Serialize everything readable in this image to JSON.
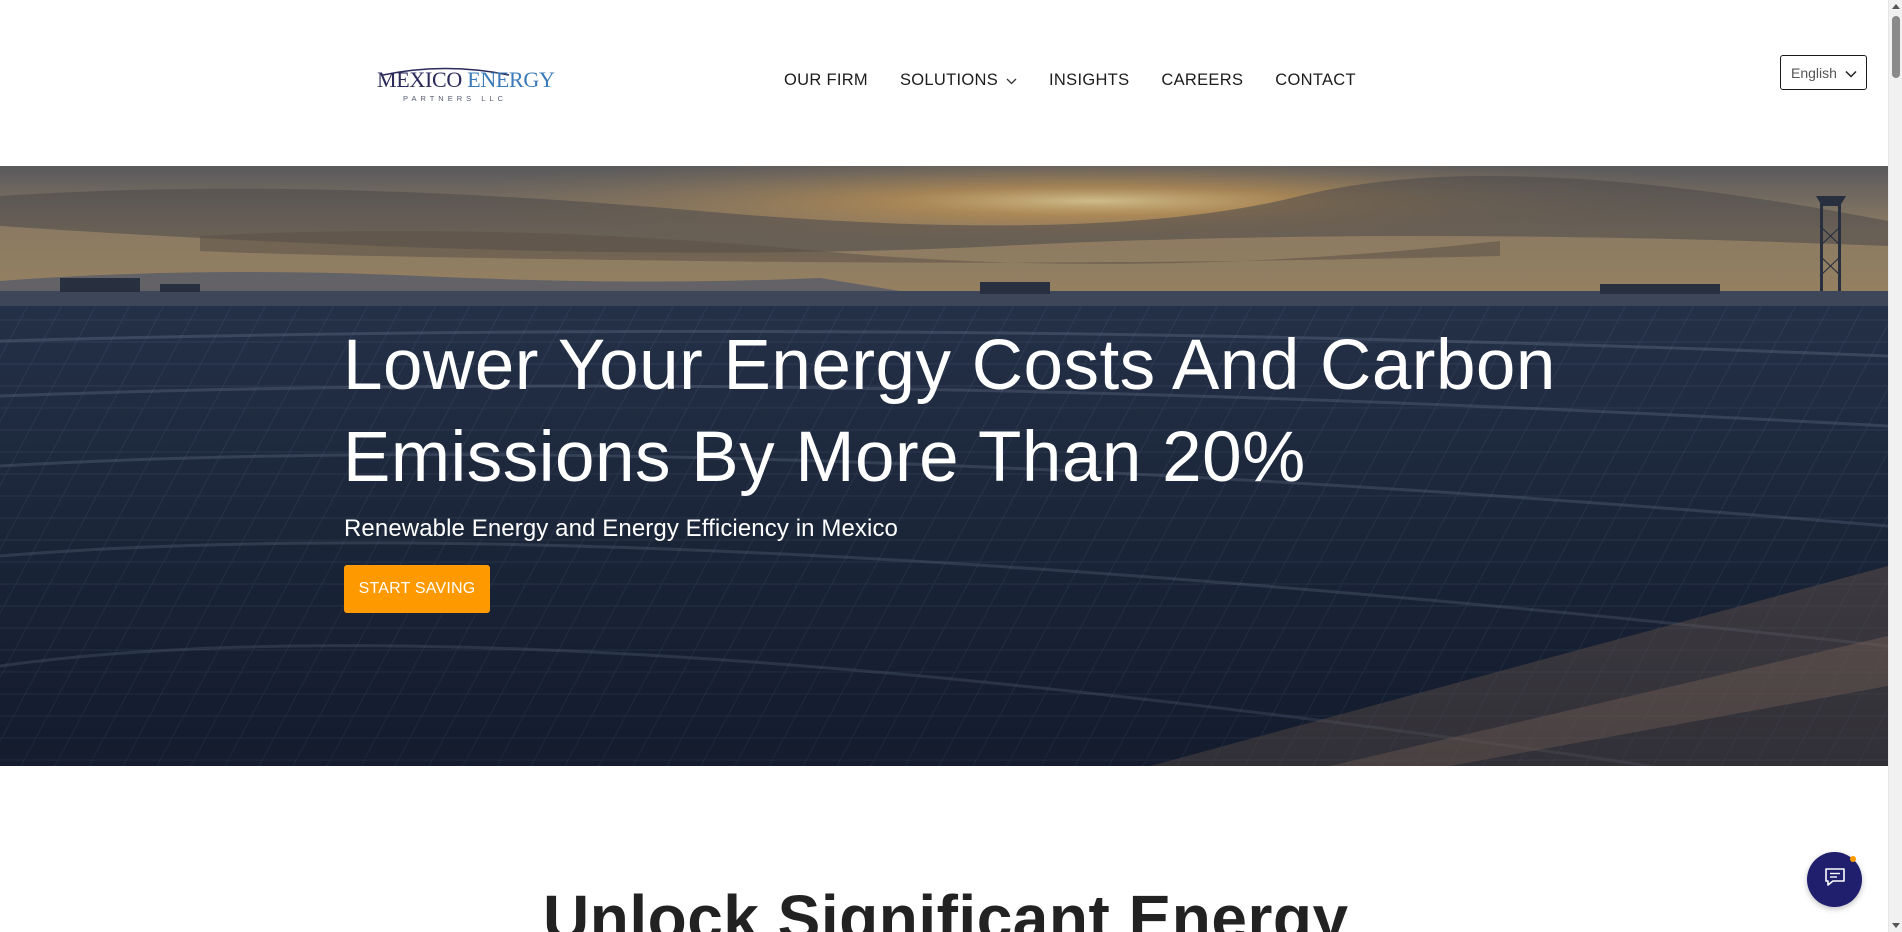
{
  "header": {
    "logo": {
      "word1": "MEXICO",
      "word2": "ENERGY",
      "sub": "PARTNERS LLC"
    },
    "nav": [
      {
        "label": "OUR FIRM"
      },
      {
        "label": "SOLUTIONS",
        "icon": "chevron-down-icon"
      },
      {
        "label": "INSIGHTS"
      },
      {
        "label": "CAREERS"
      },
      {
        "label": "CONTACT"
      }
    ],
    "language": {
      "selected": "English",
      "icon": "chevron-down-icon"
    }
  },
  "hero": {
    "title_line1": "Lower Your Energy Costs And Carbon",
    "title_line2": "Emissions By More Than 20%",
    "subtitle": "Renewable Energy and Energy Efficiency in Mexico",
    "cta_label": "START SAVING"
  },
  "section": {
    "title": "Unlock Significant Energy"
  },
  "chat": {
    "icon": "chat-icon"
  },
  "colors": {
    "accent": "#ff9900",
    "chat_bg": "#1f1f6e",
    "logo_dark": "#2b2a5c",
    "logo_blue": "#3a7ab8"
  }
}
